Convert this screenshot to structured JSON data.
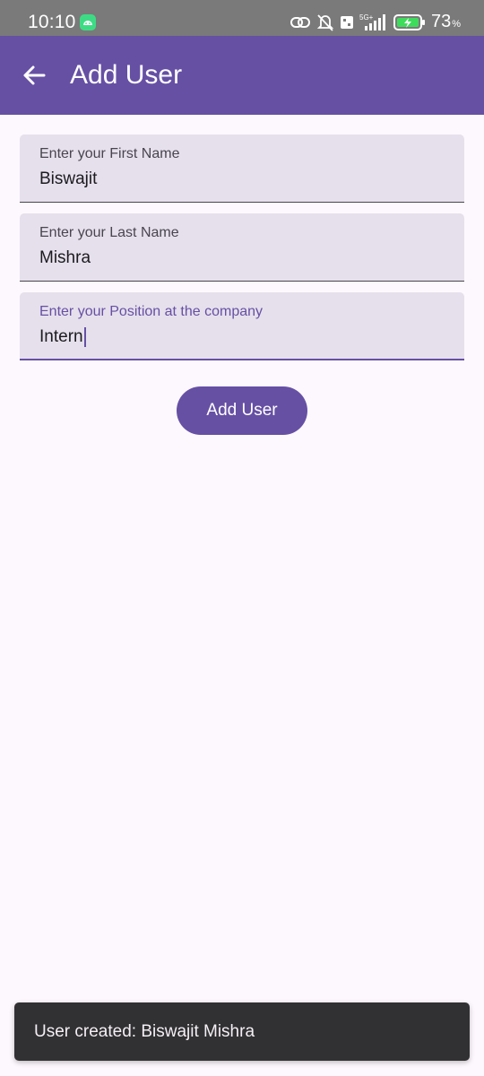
{
  "status_bar": {
    "time": "10:10",
    "battery_percent": "73",
    "battery_sign": "%",
    "network_label": "5G+",
    "icons": [
      "android-icon",
      "link-icon",
      "bell-off-icon",
      "volte-icon",
      "signal-icon",
      "battery-charging-icon"
    ]
  },
  "app_bar": {
    "title": "Add User",
    "back_icon": "arrow-back-icon",
    "color": "#6650a4"
  },
  "form": {
    "first_name": {
      "label": "Enter your First Name",
      "value": "Biswajit"
    },
    "last_name": {
      "label": "Enter your Last Name",
      "value": "Mishra"
    },
    "position": {
      "label": "Enter your Position at the company",
      "value": "Intern",
      "focused": true
    }
  },
  "add_button": {
    "label": "Add User"
  },
  "snackbar": {
    "message": "User created: Biswajit Mishra"
  }
}
